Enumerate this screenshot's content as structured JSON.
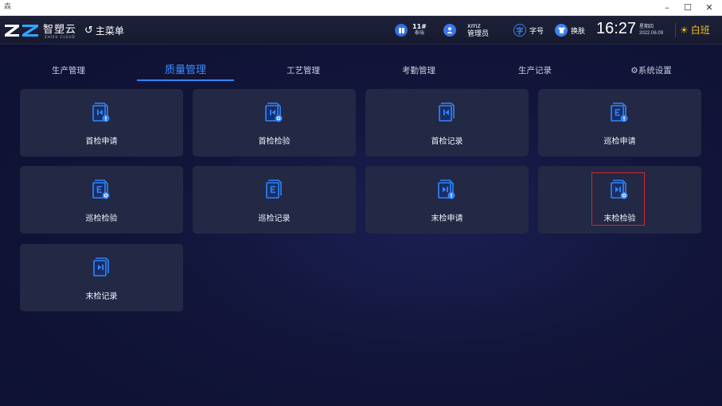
{
  "window": {
    "app_icon": "森",
    "minimize_glyph": "–",
    "maximize_glyph": "☐",
    "close_glyph": "✕"
  },
  "header": {
    "brand": "智塑云",
    "brand_sub": "ZHISU CLOUD",
    "main_menu_arrow": "↺",
    "main_menu_label": "主菜单",
    "station": {
      "code": "11#",
      "name": "泰瑞"
    },
    "user": {
      "name": "xmz",
      "role": "管理员"
    },
    "font_size_icon_glyph": "字",
    "font_size_label": "字号",
    "skin_label": "换肤",
    "time": "16:27",
    "weekday": "星期四",
    "date": "2022.06.09",
    "shift_label": "白班",
    "shift_color": "#f3c316",
    "brand_color": "#2f6fe4"
  },
  "tabs": [
    {
      "label": "生产管理",
      "active": false
    },
    {
      "label": "质量管理",
      "active": true
    },
    {
      "label": "工艺管理",
      "active": false
    },
    {
      "label": "考勤管理",
      "active": false
    },
    {
      "label": "生产记录",
      "active": false
    },
    {
      "label": "⚙系统设置",
      "active": false
    }
  ],
  "tiles": [
    {
      "label": "首检申请",
      "icon": "first-inspection-apply-icon"
    },
    {
      "label": "首检检验",
      "icon": "first-inspection-check-icon"
    },
    {
      "label": "首检记录",
      "icon": "first-inspection-record-icon"
    },
    {
      "label": "巡检申请",
      "icon": "patrol-inspection-apply-icon"
    },
    {
      "label": "巡检检验",
      "icon": "patrol-inspection-check-icon"
    },
    {
      "label": "巡检记录",
      "icon": "patrol-inspection-record-icon"
    },
    {
      "label": "末检申请",
      "icon": "final-inspection-apply-icon"
    },
    {
      "label": "末检检验",
      "icon": "final-inspection-check-icon",
      "highlighted": true
    },
    {
      "label": "末检记录",
      "icon": "final-inspection-record-icon"
    }
  ],
  "colors": {
    "accent": "#2f86ff",
    "tile_bg": "#232845",
    "highlight": "#d22a2a"
  }
}
